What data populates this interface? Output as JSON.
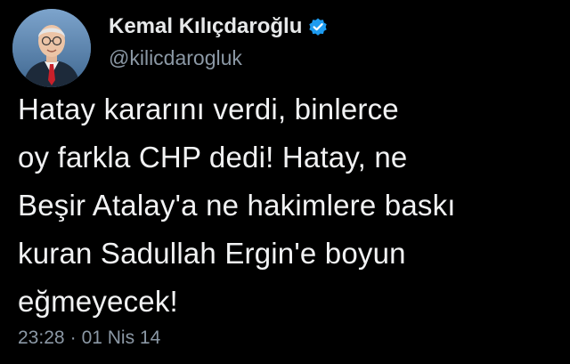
{
  "tweet": {
    "author": {
      "display_name": "Kemal Kılıçdaroğlu",
      "handle": "@kilicdarogluk",
      "verified_icon": "verified-badge-icon",
      "avatar_icon": "avatar-photo"
    },
    "text": "Hatay kararını verdi, binlerce\noy farkla CHP dedi! Hatay, ne\nBeşir Atalay'a ne hakimlere baskı\nkuran Sadullah Ergin'e boyun\neğmeyecek!",
    "time": "23:28",
    "separator": "·",
    "date": "01 Nis 14"
  },
  "colors": {
    "background": "#000000",
    "text": "#e7e9ea",
    "secondary": "#8b98a5",
    "verified": "#1d9bf0"
  }
}
